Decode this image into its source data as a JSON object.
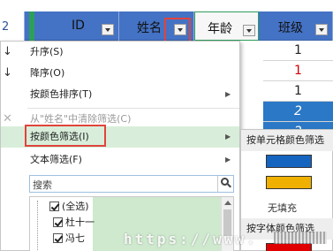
{
  "row_number": "2",
  "headers": [
    "ID",
    "姓名",
    "年龄",
    "班级"
  ],
  "column_e_values": [
    "1",
    "1",
    "1",
    "2",
    "2"
  ],
  "menu": {
    "sort_asc": "升序(S)",
    "sort_desc": "降序(O)",
    "sort_by_color": "按颜色排序(T)",
    "clear_filter": "从\"姓名\"中清除筛选(C)",
    "filter_by_color": "按颜色筛选(I)",
    "text_filter": "文本筛选(F)",
    "search_placeholder": "搜索",
    "list_items": [
      "(全选)",
      "杜十一",
      "冯七"
    ]
  },
  "submenu": {
    "cell_color_header": "按单元格颜色筛选",
    "no_fill": "无填充",
    "font_color_header": "按字体颜色筛选",
    "swatches": [
      "#1565c0",
      "#f0b000",
      "#e00000"
    ]
  },
  "watermark": "https://www."
}
